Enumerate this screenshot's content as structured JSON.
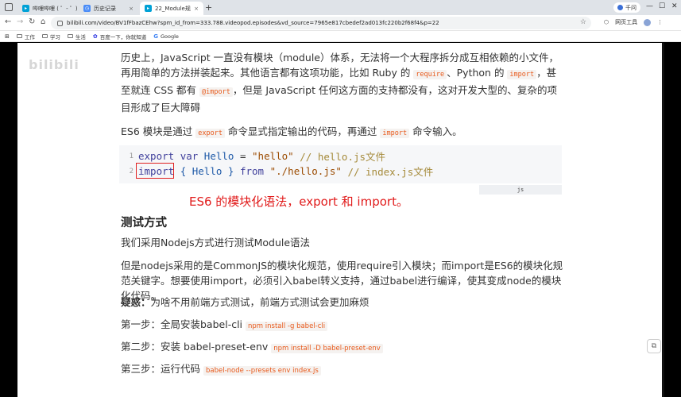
{
  "tabs": [
    {
      "label": "哔哩哔哩 ( ゜- ゜)つロ",
      "favicon_color": "#00a1d6"
    },
    {
      "label": "历史记录",
      "favicon_color": "#4a8cf7"
    },
    {
      "label": "22_Module规",
      "favicon_color": "#00a1d6"
    }
  ],
  "tab_close": "×",
  "new_tab": "+",
  "profile": {
    "label": "千问"
  },
  "window_buttons": {
    "minimize": "—",
    "maximize": "☐",
    "close": "✕"
  },
  "address": {
    "url": "bilibili.com/video/BV1fFbazCEhw?spm_id_from=333.788.videopod.episodes&vd_source=7965e817cbedef2ad013fc220b2f68f4&p=22"
  },
  "toolbar_right": {
    "tools_label": "网页工具"
  },
  "bookmarks": [
    {
      "label": "工作",
      "type": "folder"
    },
    {
      "label": "学习",
      "type": "folder"
    },
    {
      "label": "生活",
      "type": "folder"
    },
    {
      "label": "百度一下，你就知道",
      "type": "link"
    },
    {
      "label": "Google",
      "type": "google"
    }
  ],
  "watermark": "bilibili",
  "content": {
    "history": {
      "t1": "历史上，JavaScript 一直没有模块（module）体系，无法将一个大程序拆分成互相依赖的小文件，再用简单的方法拼装起来。其他语言都有这项功能，比如 Ruby 的 ",
      "c1": "require",
      "t2": "、Python 的 ",
      "c2": "import",
      "t3": "，甚至就连 CSS 都有 ",
      "c3": "@import",
      "t4": "，但是 JavaScript 任何这方面的支持都没有，这对开发大型的、复杂的项目形成了巨大障碍"
    },
    "es6_intro": {
      "t1": "ES6 模块是通过 ",
      "c1": "export",
      "t2": " 命令显式指定输出的代码，再通过 ",
      "c2": "import",
      "t3": " 命令输入。"
    },
    "code": {
      "line1": {
        "num": "1",
        "kw1": "export",
        "kw2": "var",
        "name": "Hello",
        "eq": "=",
        "str": "\"hello\"",
        "comment": "// hello.js文件"
      },
      "line2": {
        "num": "2",
        "kw1": "import",
        "brace": "{ Hello }",
        "from": "from",
        "str": "\"./hello.js\"",
        "comment": "// index.js文件"
      },
      "lang": "js"
    },
    "annotation": "ES6 的模块化语法，export 和 import。",
    "heading": "测试方式",
    "node_para": "我们采用Nodejs方式进行测试Module语法",
    "commonjs_para": "但是nodejs采用的是CommonJS的模块化规范，使用require引入模块；而import是ES6的模块化规范关键字。想要使用import，必须引入babel转义支持，通过babel进行编译，使其变成node的模块化代码。",
    "question": {
      "label": "疑惑：",
      "text": "为啥不用前端方式测试，前端方式测试会更加麻烦"
    },
    "steps": [
      {
        "text": "第一步：全局安装babel-cli ",
        "cmd": "npm install -g babel-cli"
      },
      {
        "text": "第二步：安装 babel-preset-env ",
        "cmd": "npm install -D babel-preset-env"
      },
      {
        "text": "第三步：运行代码 ",
        "cmd": "babel-node --presets env index.js"
      }
    ]
  },
  "colors": {
    "accent": "#e11b1b",
    "inline_code": "#e85a1c"
  }
}
